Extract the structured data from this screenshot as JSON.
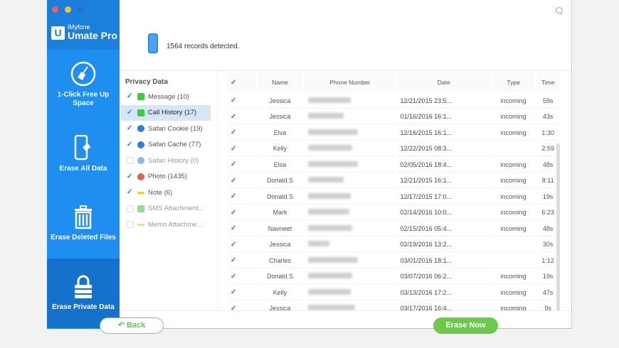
{
  "app": {
    "brand_small": "iMyfone",
    "brand": "Umate Pro",
    "logo_letter": "U"
  },
  "sidebar": [
    {
      "label": "1-Click Free Up Space"
    },
    {
      "label": "Erase All Data"
    },
    {
      "label": "Erase Deleted Files"
    },
    {
      "label": "Erase Private Data"
    }
  ],
  "header": {
    "records": "1564 records detected."
  },
  "privacy": {
    "title": "Privacy Data",
    "items": [
      {
        "label": "Message (10)",
        "checked": true,
        "color": "#3ccf3c"
      },
      {
        "label": "Call History (17)",
        "checked": true,
        "color": "#3ccf3c"
      },
      {
        "label": "Safari Cookie (19)",
        "checked": true,
        "color": "#2a7de0"
      },
      {
        "label": "Safari Cache (77)",
        "checked": true,
        "color": "#2a7de0"
      },
      {
        "label": "Safari History (0)",
        "checked": false,
        "color": "#8ab8ee"
      },
      {
        "label": "Photo (1435)",
        "checked": true,
        "color": "#e0604a"
      },
      {
        "label": "Note (6)",
        "checked": true,
        "color": "#f5d020"
      },
      {
        "label": "SMS Attachment...",
        "checked": false,
        "color": "#8ee08e"
      },
      {
        "label": "Memo Attachme...",
        "checked": false,
        "color": "#f5e070"
      }
    ]
  },
  "table": {
    "headers": [
      "Name",
      "Phone Number",
      "Date",
      "Type",
      "Time"
    ],
    "rows": [
      [
        "Jessica",
        "12/21/2015 23:5...",
        "incoming",
        "59s"
      ],
      [
        "Jessica",
        "01/16/2016 16:1...",
        "incoming",
        "43s"
      ],
      [
        "Elva",
        "12/16/2015 16:1...",
        "incoming",
        "1:30"
      ],
      [
        "Kelly",
        "12/22/2015 08:3...",
        "",
        "2:59"
      ],
      [
        "Elsa",
        "02/05/2016 18:4...",
        "incoming",
        "48s"
      ],
      [
        "Donald.S",
        "12/21/2015 16:1...",
        "incoming",
        "8:11"
      ],
      [
        "Donald.S",
        "12/17/2015 17:0...",
        "incoming",
        "19s"
      ],
      [
        "Mark",
        "02/14/2016 10:0...",
        "incoming",
        "6:23"
      ],
      [
        "Navneet",
        "02/15/2016 05:4...",
        "incoming",
        "48s"
      ],
      [
        "Jessica",
        "02/19/2016 13:2...",
        "",
        "30s"
      ],
      [
        "Charles",
        "03/01/2016 18:1...",
        "",
        "1:12"
      ],
      [
        "Donald.S",
        "03/07/2016 06:2...",
        "incoming",
        "19s"
      ],
      [
        "Kelly",
        "03/13/2016 17:2...",
        "incoming",
        "47s"
      ],
      [
        "Jessica",
        "03/17/2016 16:4...",
        "incoming",
        "9s"
      ]
    ]
  },
  "buttons": {
    "back": "Back",
    "erase": "Erase Now"
  }
}
